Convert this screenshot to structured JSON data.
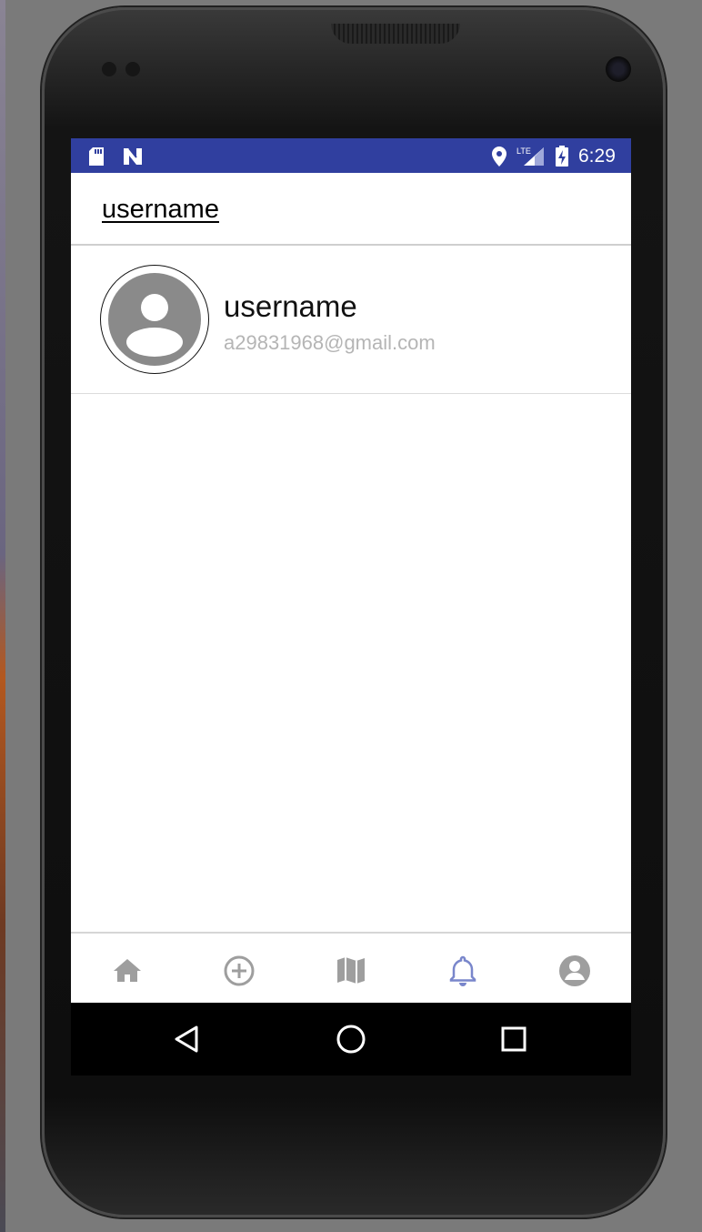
{
  "status_bar": {
    "time": "6:29",
    "icons": [
      "sd-card-icon",
      "n-icon",
      "location-icon",
      "lte-signal-icon",
      "battery-charging-icon"
    ],
    "background": "#303f9f"
  },
  "header": {
    "title": "username"
  },
  "user_item": {
    "name": "username",
    "email": "a29831968@gmail.com",
    "avatar_icon": "account-placeholder-icon"
  },
  "bottom_nav": {
    "items": [
      {
        "icon": "home-icon",
        "active": false
      },
      {
        "icon": "add-circle-icon",
        "active": false
      },
      {
        "icon": "map-icon",
        "active": false
      },
      {
        "icon": "notifications-icon",
        "active": true
      },
      {
        "icon": "account-icon",
        "active": false
      }
    ],
    "active_color": "#7986cb",
    "inactive_color": "#9e9e9e"
  },
  "system_nav": {
    "buttons": [
      "back-icon",
      "home-circle-icon",
      "recents-icon"
    ]
  }
}
